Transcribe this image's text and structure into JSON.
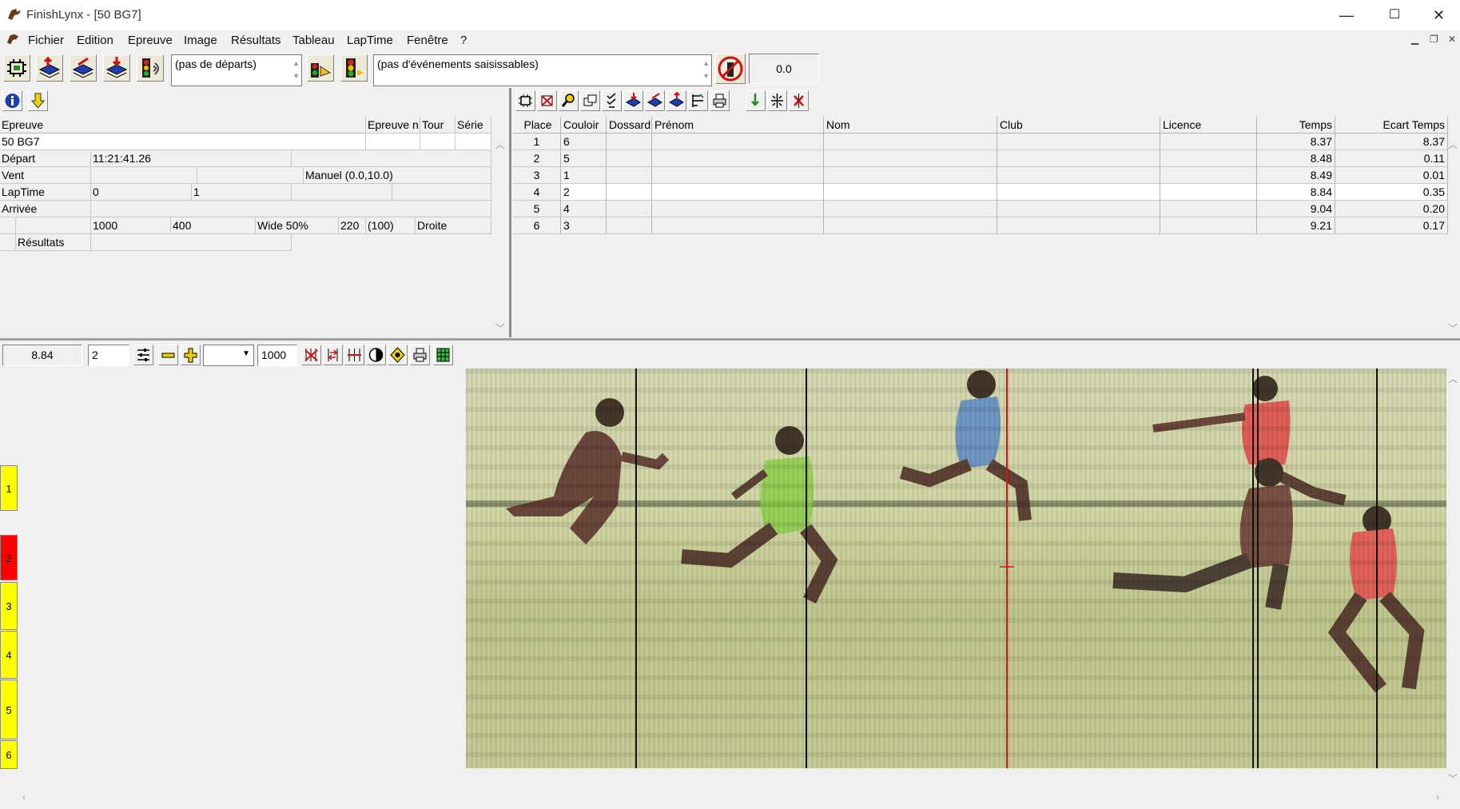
{
  "window": {
    "title": "FinishLynx - [50 BG7]",
    "minimize": "—",
    "maximize": "☐",
    "close": "✕"
  },
  "menu": [
    "Fichier",
    "Edition",
    "Epreuve",
    "Image",
    "Résultats",
    "Tableau",
    "LapTime",
    "Fenêtre",
    "?"
  ],
  "toolbar": {
    "starts_combo": "(pas de départs)",
    "events_combo": "(pas d'événements saisissables)",
    "wind_value": "0.0"
  },
  "event_info": {
    "headers": {
      "epreuve": "Epreuve",
      "epreuve_n": "Epreuve n",
      "tour": "Tour",
      "serie": "Série"
    },
    "epreuve_value": "50 BG7",
    "depart_label": "Départ",
    "depart_value": "11:21:41.26",
    "vent_label": "Vent",
    "vent_value": "Manuel (0.0,10.0)",
    "laptime_label": "LapTime",
    "laptime_a": "0",
    "laptime_b": "1",
    "arrivee_label": "Arrivée",
    "distance": "1000",
    "v400": "400",
    "wide": "Wide 50%",
    "v220": "220",
    "v100": "(100)",
    "droite": "Droite",
    "resultats_label": "Résultats"
  },
  "results": {
    "columns": [
      "Place",
      "Couloir",
      "Dossard",
      "Prénom",
      "Nom",
      "Club",
      "Licence",
      "Temps",
      "Ecart Temps"
    ],
    "rows": [
      {
        "place": "1",
        "couloir": "6",
        "temps": "8.37",
        "ecart": "8.37"
      },
      {
        "place": "2",
        "couloir": "5",
        "temps": "8.48",
        "ecart": "0.11"
      },
      {
        "place": "3",
        "couloir": "1",
        "temps": "8.49",
        "ecart": "0.01"
      },
      {
        "place": "4",
        "couloir": "2",
        "temps": "8.84",
        "ecart": "0.35"
      },
      {
        "place": "5",
        "couloir": "4",
        "temps": "9.04",
        "ecart": "0.20"
      },
      {
        "place": "6",
        "couloir": "3",
        "temps": "9.21",
        "ecart": "0.17"
      }
    ]
  },
  "image_toolbar": {
    "time": "8.84",
    "lane": "2",
    "density": "1000"
  },
  "lanes": [
    "1",
    "2",
    "3",
    "4",
    "5",
    "6"
  ],
  "colors": {
    "lane_yellow": "#ffff00",
    "lane_red": "#ff0000",
    "cursor_red": "#dd1111"
  }
}
